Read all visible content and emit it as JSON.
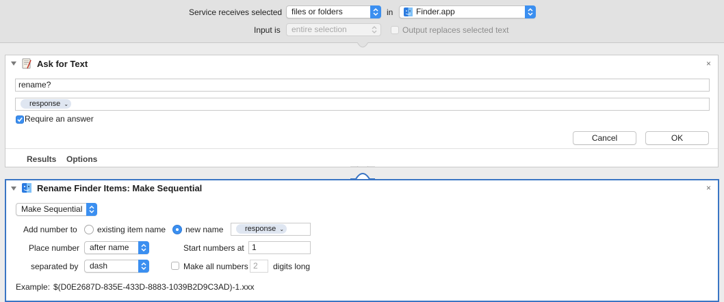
{
  "service_bar": {
    "receives_label": "Service receives selected",
    "receives_value": "files or folders",
    "in_label": "in",
    "app_value": "Finder.app",
    "input_is_label": "Input is",
    "input_is_value": "entire selection",
    "output_replaces_label": "Output replaces selected text",
    "output_replaces_checked": false
  },
  "ask_for_text": {
    "title": "Ask for Text",
    "close_symbol": "×",
    "question_value": "rename?",
    "response_token": "response",
    "require_answer_label": "Require an answer",
    "require_answer_checked": true,
    "cancel_label": "Cancel",
    "ok_label": "OK",
    "footer_tabs": [
      "Results",
      "Options"
    ]
  },
  "rename_items": {
    "title": "Rename Finder Items: Make Sequential",
    "close_symbol": "×",
    "mode_value": "Make Sequential",
    "add_number_label": "Add number to",
    "existing_name_label": "existing item name",
    "new_name_label": "new name",
    "new_name_selected": true,
    "new_name_token": "response",
    "place_number_label": "Place number",
    "place_number_value": "after name",
    "start_numbers_label": "Start numbers at",
    "start_numbers_value": "1",
    "separated_by_label": "separated by",
    "separated_by_value": "dash",
    "make_all_numbers_label": "Make all numbers",
    "make_all_numbers_checked": false,
    "digits_value": "2",
    "digits_long_label": "digits long",
    "example_label": "Example:",
    "example_value": "$(D0E2687D-835E-433D-8883-1039B2D9C3AD)-1.xxx"
  },
  "colors": {
    "accent": "#3b8ff0",
    "selected_border": "#3a75c4",
    "token_bg": "#dfe6f1"
  }
}
